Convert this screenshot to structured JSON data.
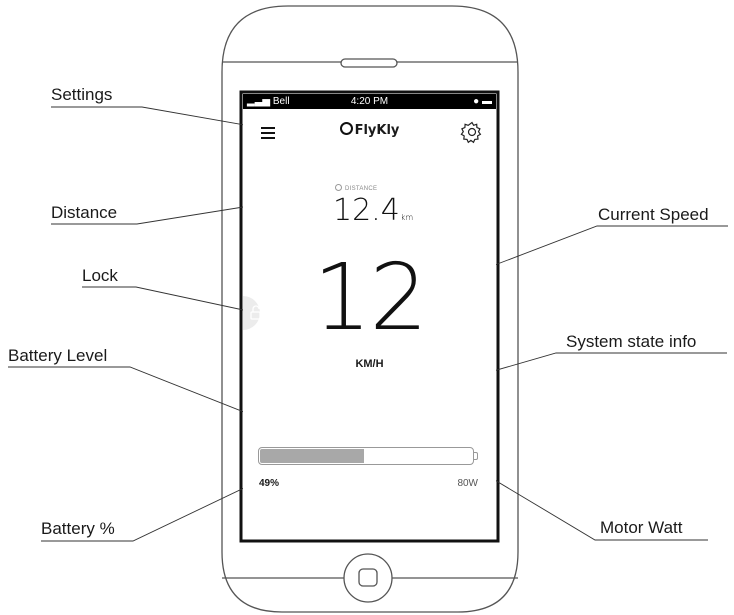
{
  "callouts": {
    "settings": "Settings",
    "distance": "Distance",
    "lock": "Lock",
    "battery_level": "Battery Level",
    "battery_pct": "Battery %",
    "current_speed": "Current Speed",
    "system_state": "System state info",
    "motor_watt": "Motor Watt"
  },
  "status_bar": {
    "carrier": "Bell",
    "time": "4:20 PM"
  },
  "app": {
    "logo": "FlyKly",
    "distance_label": "DISTANCE",
    "distance_value": "12.4",
    "distance_unit": "km",
    "speed_value": "12",
    "speed_unit": "KM/H",
    "battery_percent_label": "49%",
    "battery_level": 0.49,
    "motor_watt": "80W"
  },
  "icons": {
    "menu": "hamburger-menu-icon",
    "settings": "gear-icon",
    "lock": "lock-icon",
    "distance": "distance-icon",
    "home": "home-button"
  }
}
